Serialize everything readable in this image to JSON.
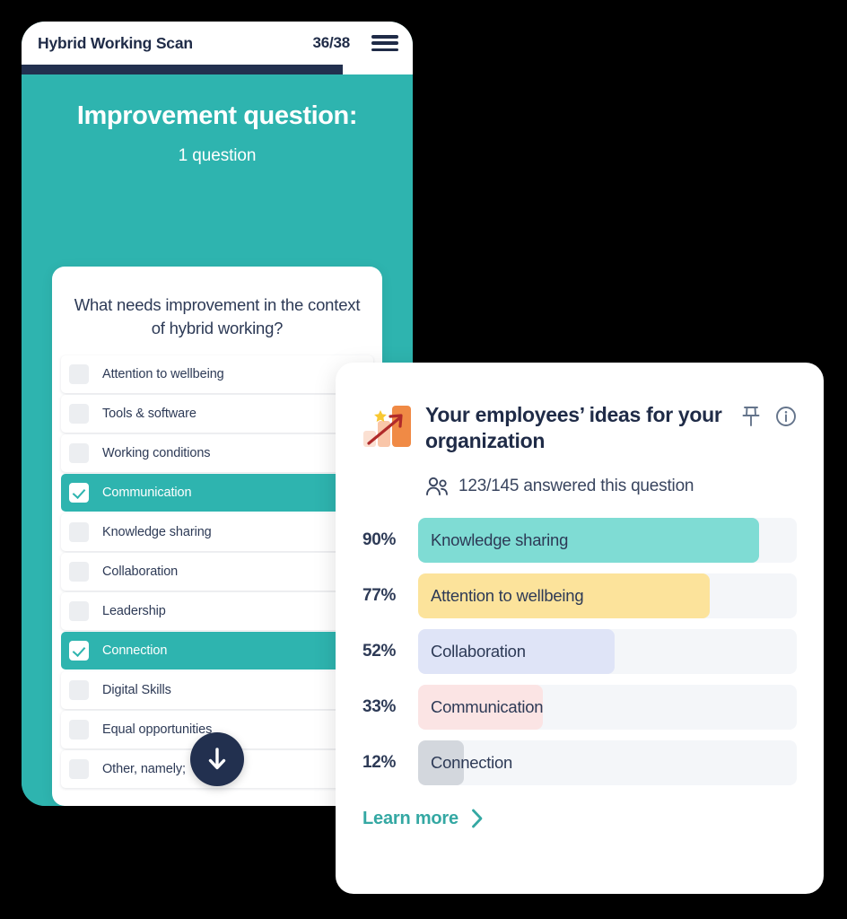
{
  "phone": {
    "header": {
      "app_title": "Hybrid Working Scan",
      "progress_count": "36/38",
      "menu_icon": "hamburger-menu-icon"
    },
    "progress_percent": 82,
    "section_title": "Improvement question:",
    "section_subtitle": "1 question",
    "question": "What needs improvement in the context of hybrid working?",
    "options": [
      {
        "label": "Attention to wellbeing",
        "checked": false
      },
      {
        "label": "Tools & software",
        "checked": false
      },
      {
        "label": "Working conditions",
        "checked": false
      },
      {
        "label": "Communication",
        "checked": true
      },
      {
        "label": "Knowledge sharing",
        "checked": false
      },
      {
        "label": "Collaboration",
        "checked": false
      },
      {
        "label": "Leadership",
        "checked": false
      },
      {
        "label": "Connection",
        "checked": true
      },
      {
        "label": "Digital Skills",
        "checked": false
      },
      {
        "label": "Equal opportunities",
        "checked": false
      },
      {
        "label": "Other, namely;",
        "checked": false
      }
    ],
    "scroll_button_icon": "arrow-down-icon"
  },
  "results_card": {
    "icon": "bar-chart-growth-icon",
    "title": "Your employees’ ideas for your organization",
    "pin_icon": "pin-icon",
    "info_icon": "info-circle-icon",
    "people_icon": "people-icon",
    "answered_text": "123/145 answered this question",
    "learn_more_label": "Learn more",
    "learn_more_icon": "chevron-right-icon"
  },
  "chart_data": {
    "type": "bar",
    "title": "Your employees’ ideas for your organization",
    "xlabel": "",
    "ylabel": "",
    "xlim": [
      0,
      100
    ],
    "grid": false,
    "legend": "none",
    "orientation": "horizontal",
    "categories": [
      "Knowledge sharing",
      "Attention to wellbeing",
      "Collaboration",
      "Communication",
      "Connection"
    ],
    "values": [
      90,
      77,
      52,
      33,
      12
    ],
    "value_labels": [
      "90%",
      "77%",
      "52%",
      "33%",
      "12%"
    ],
    "colors": [
      "#7FDCD4",
      "#FCE39B",
      "#DFE4F7",
      "#FBE4E4",
      "#D3D7DD"
    ],
    "track_color": "#F4F6F9"
  },
  "colors": {
    "brand_teal": "#2EB4AF",
    "navy": "#22304F",
    "text_dark": "#2D3A56",
    "link_teal": "#34A8A3",
    "page_background": "#000000"
  }
}
